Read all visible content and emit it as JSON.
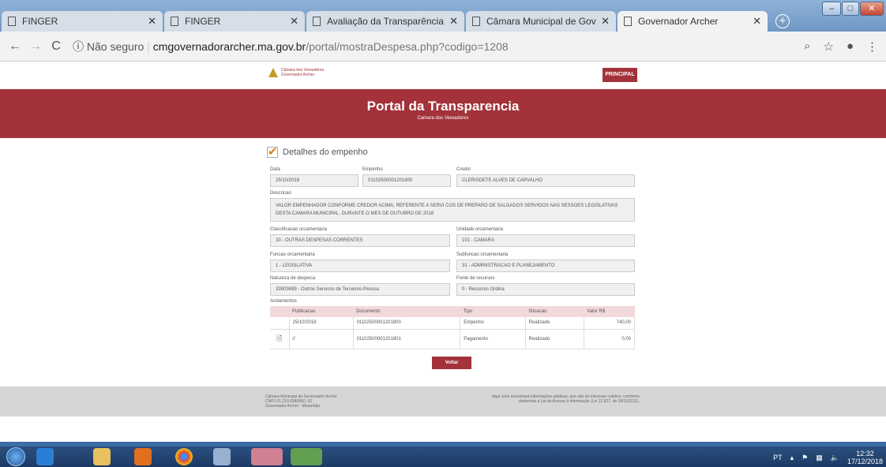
{
  "browser": {
    "tabs": [
      {
        "title": "FINGER",
        "active": false
      },
      {
        "title": "FINGER",
        "active": false
      },
      {
        "title": "Avaliação da Transparência do",
        "active": false
      },
      {
        "title": "Câmara Municipal de Governa",
        "active": false
      },
      {
        "title": "Governador Archer",
        "active": true
      }
    ],
    "new_tab": "+",
    "security": "Não seguro",
    "url_domain": "cmgovernadorarcher.ma.gov.br",
    "url_path": "/portal/mostraDespesa.php?codigo=1208"
  },
  "site": {
    "logo_line1": "Câmara dos Vereadores",
    "logo_line2": "Governador Archer",
    "principal": "PRINCIPAL",
    "title": "Portal da Transparencia",
    "subtitle": "Camara dos Vereadores"
  },
  "form": {
    "section_title": "Detalhes do empenho",
    "data_label": "Data",
    "data_value": "25/10/2018",
    "empenho_label": "Empenho",
    "empenho_value": "01102500001201800",
    "credor_label": "Credor",
    "credor_value": "CLERISDETE ALVES DE CARVALHO",
    "descricao_label": "Descricao",
    "descricao_value": "VALOR EMPENHADOR CONFORME CREDOR ACIMA, REFERENTE A SERVI COS DE PREPARO DE SALGADOS SERVIDOS NAS SESSOES LEGISLATIVAS DESTA CAMARA MUNICIPAL, DURANTE O MES DE OUTUBRO DE 2018",
    "classificacao_label": "Classificacao orcamentaria",
    "classificacao_value": "33 - OUTRAS DESPESAS CORRENTES",
    "unidade_label": "Unidade orcamentaria",
    "unidade_value": "101 - CAMARA",
    "funcao_label": "Funcao orcamentaria",
    "funcao_value": "1 - LEGISLATIVA",
    "subfuncao_label": "Subfuncao orcamentaria",
    "subfuncao_value": "31 - ADMINISTRACAO E PLANEJAMENTO",
    "natureza_label": "Natureza de despeca",
    "natureza_value": "33903699 - Outros Servicos de Terceiros-Pessoa",
    "fonte_label": "Fonte de recursos",
    "fonte_value": "0 - Recursos Ordina",
    "andamentos_label": "Andamentos"
  },
  "table": {
    "headers": [
      "Publicacao",
      "Documento",
      "Tipo",
      "Situacao",
      "Valor R$"
    ],
    "rows": [
      {
        "publicacao": "25/10/2018",
        "documento": "01102500001201800",
        "tipo": "Empenho",
        "situacao": "Realizado",
        "valor": "740,00"
      },
      {
        "publicacao": "//",
        "documento": "01102500001201801",
        "tipo": "Pagamento",
        "situacao": "Realizado",
        "valor": "0,00"
      }
    ]
  },
  "voltar": "Voltar",
  "footer": {
    "l1": "Câmara Municipal de Governador Archer",
    "l2": "CNPJ 01.210.698/0001-32",
    "l3": "Governador Archer - Maranhão",
    "r1": "Aqui você encontrará informações públicas, que são de interesse coletivo, conforme",
    "r2": "determina a Lei de Acesso à Informação (Lei 12.527, de 18/11/2011)."
  },
  "taskbar": {
    "lang": "PT",
    "time": "12:32",
    "date": "17/12/2018"
  }
}
